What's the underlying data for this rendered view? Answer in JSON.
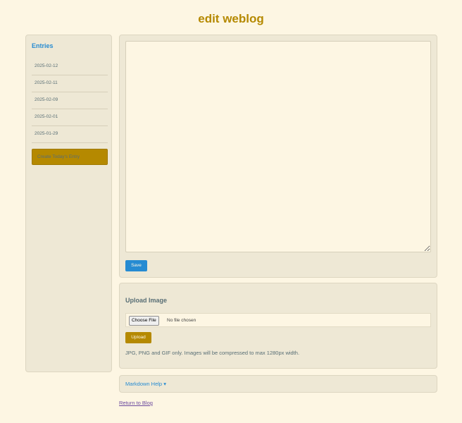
{
  "header": {
    "title": "edit weblog"
  },
  "sidebar": {
    "title": "Entries",
    "entries": [
      "2025-02-12",
      "2025-02-11",
      "2025-02-09",
      "2025-02-01",
      "2025-01-29"
    ],
    "create_label": "Create Today's Entry"
  },
  "editor": {
    "content": "",
    "save_label": "Save"
  },
  "upload": {
    "title": "Upload Image",
    "choose_label": "Choose File",
    "no_file_text": "No file chosen",
    "button_label": "Upload",
    "hint": "JPG, PNG and GIF only. Images will be compressed to max 1280px width."
  },
  "markdown_help": {
    "label": "Markdown Help ▾"
  },
  "footer": {
    "return_label": "Return to Blog"
  },
  "colors": {
    "background": "#fdf6e3",
    "panel": "#eee8d5",
    "accent_gold": "#b58900",
    "accent_blue": "#268bd2",
    "text": "#586e75"
  }
}
